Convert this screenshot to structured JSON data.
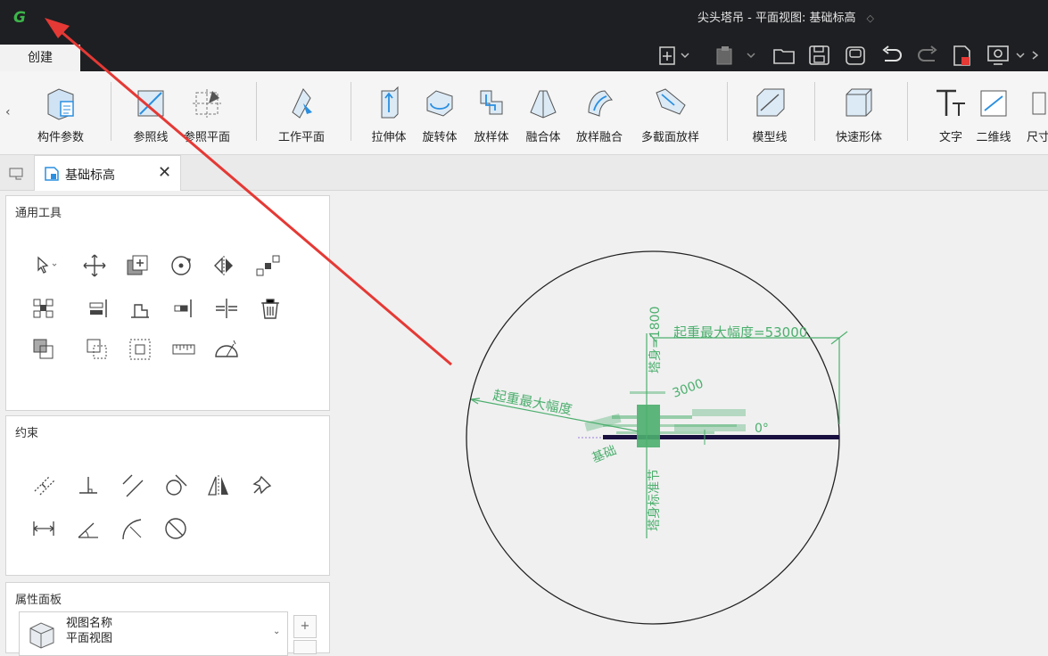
{
  "app": {
    "title": "尖头塔吊 - 平面视图: 基础标高",
    "accent": "#2a8fe0",
    "logo_color": "#3cb54a"
  },
  "ribbon_tab": "创建",
  "ribbon": {
    "buttons": [
      {
        "id": "component-params",
        "label": "构件参数"
      },
      {
        "id": "ref-line",
        "label": "参照线"
      },
      {
        "id": "ref-plane",
        "label": "参照平面"
      },
      {
        "id": "work-plane",
        "label": "工作平面"
      },
      {
        "id": "extrude",
        "label": "拉伸体"
      },
      {
        "id": "revolve",
        "label": "旋转体"
      },
      {
        "id": "sweep",
        "label": "放样体"
      },
      {
        "id": "blend",
        "label": "融合体"
      },
      {
        "id": "sweep-blend",
        "label": "放样融合"
      },
      {
        "id": "multi-section",
        "label": "多截面放样"
      },
      {
        "id": "model-line",
        "label": "模型线"
      },
      {
        "id": "quick-shape",
        "label": "快速形体"
      },
      {
        "id": "text",
        "label": "文字"
      },
      {
        "id": "2d-line",
        "label": "二维线"
      },
      {
        "id": "dimension",
        "label": "尺寸"
      }
    ]
  },
  "doc_tab": {
    "label": "基础标高"
  },
  "panels": {
    "general_tools": "通用工具",
    "constraints": "约束",
    "properties": "属性面板",
    "view_name_label": "视图名称",
    "view_name_value": "平面视图"
  },
  "drawing": {
    "annotations": {
      "max_radius_right": "起重最大幅度=53000",
      "max_radius_left": "起重最大幅度",
      "vertical": "塔身=1800",
      "vertical_lower": "塔身标准节",
      "base": "基础",
      "angle": "0°",
      "misc": "3000"
    },
    "colors": {
      "annotation": "#4caf6e",
      "outline": "#222222",
      "boom": "#1a1040",
      "arrow": "#e53935"
    }
  }
}
